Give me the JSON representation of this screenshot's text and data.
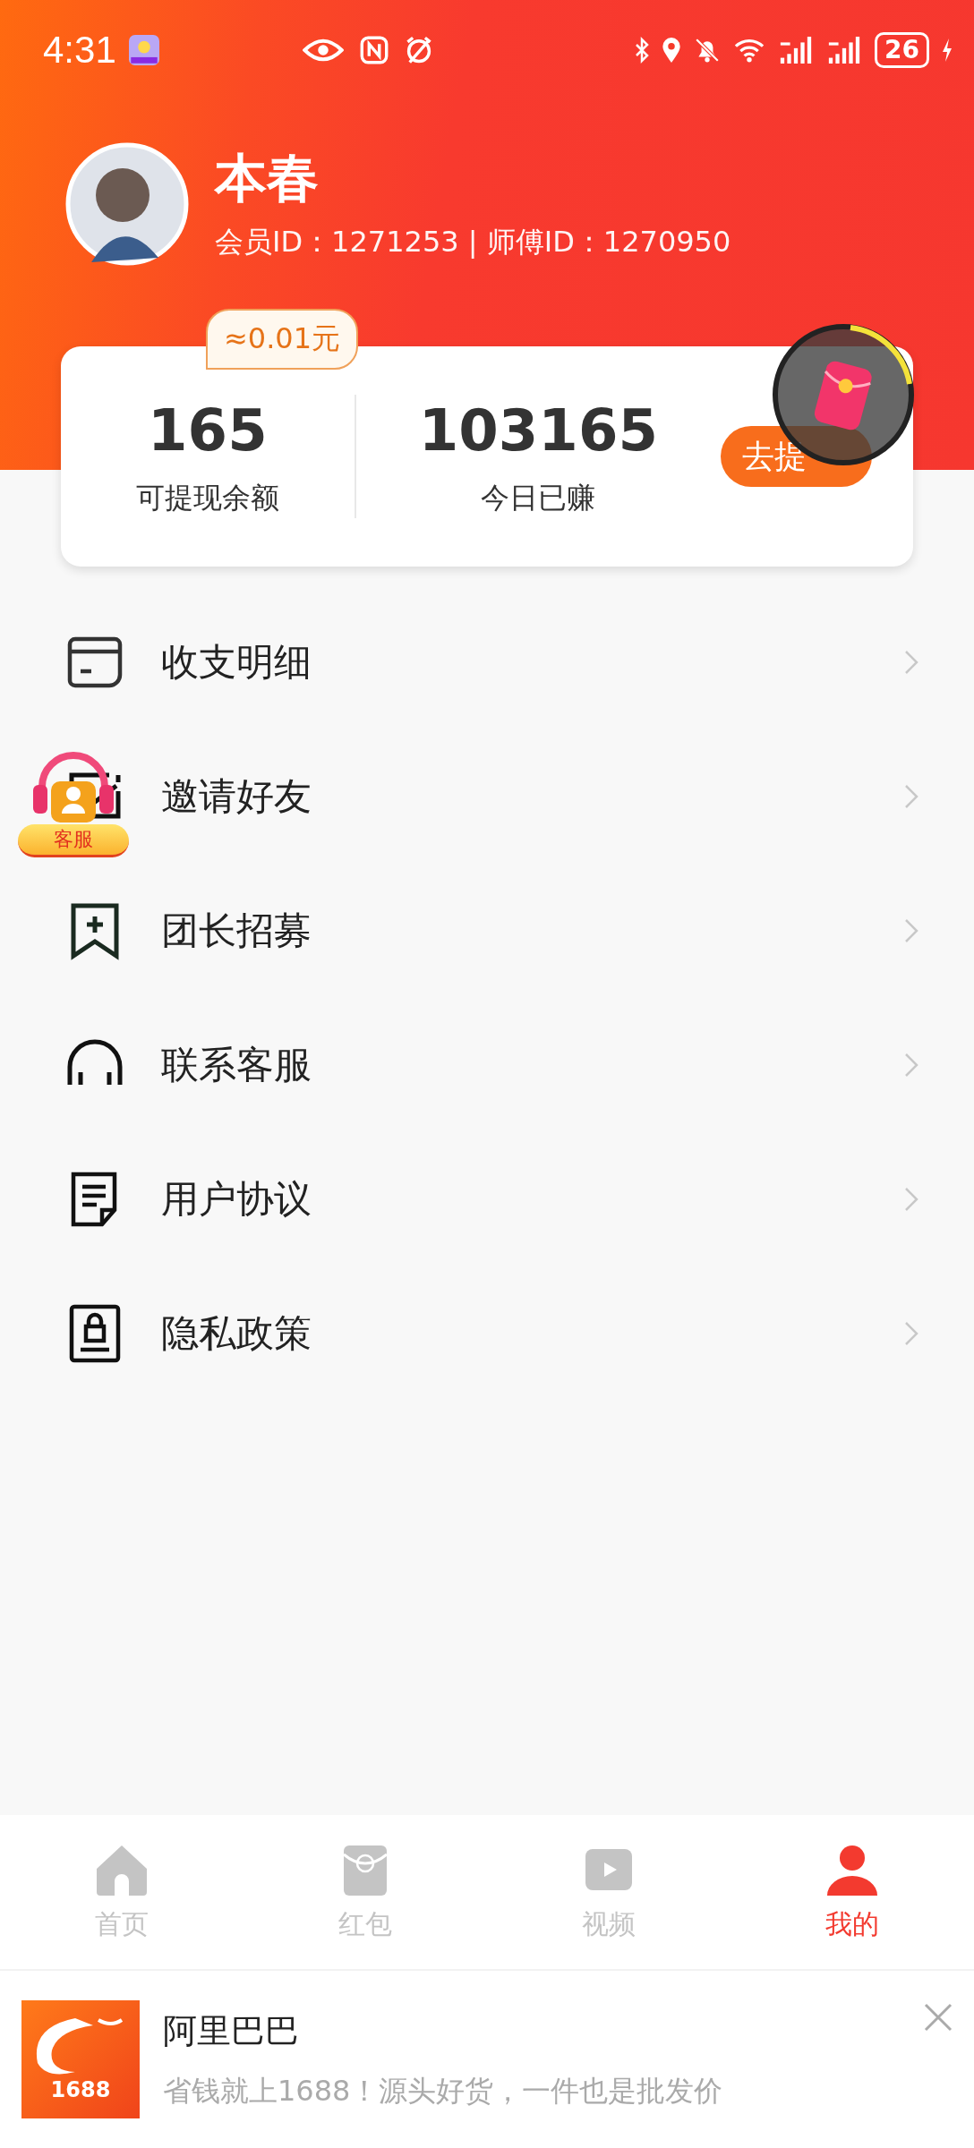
{
  "status_bar": {
    "time": "4:31",
    "battery": "26"
  },
  "profile": {
    "name": "本春",
    "ids": "会员ID：1271253 | 师傅ID：1270950"
  },
  "balance_card": {
    "bubble": "≈0.01元",
    "stats": [
      {
        "value": "165",
        "label": "可提现余额"
      },
      {
        "value": "103165",
        "label": "今日已赚"
      }
    ],
    "button": "去提"
  },
  "menu": [
    {
      "kind": "card",
      "label": "收支明细"
    },
    {
      "kind": "mail",
      "label": "邀请好友"
    },
    {
      "kind": "bookmark",
      "label": "团长招募"
    },
    {
      "kind": "headset",
      "label": "联系客服"
    },
    {
      "kind": "document",
      "label": "用户协议"
    },
    {
      "kind": "lock",
      "label": "隐私政策"
    }
  ],
  "service_badge": "客服",
  "tab_bar": [
    {
      "kind": "home",
      "label": "首页",
      "selected": false
    },
    {
      "kind": "packet",
      "label": "红包",
      "selected": false
    },
    {
      "kind": "video",
      "label": "视频",
      "selected": false
    },
    {
      "kind": "profile",
      "label": "我的",
      "selected": true
    }
  ],
  "ad": {
    "logo_text": "1688",
    "title": "阿里巴巴",
    "text": "省钱就上1688！源头好货，一件也是批发价"
  }
}
